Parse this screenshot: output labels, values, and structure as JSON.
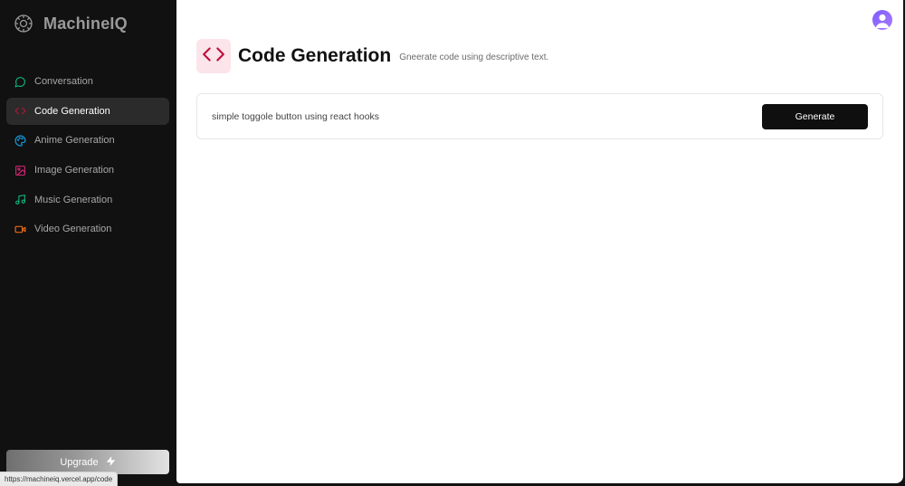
{
  "brand": {
    "name": "MachineIQ",
    "logo_icon": "brain-gear-icon"
  },
  "sidebar": {
    "items": [
      {
        "label": "Conversation",
        "icon": "chat-bubble-icon",
        "color": "#10b981",
        "active": false
      },
      {
        "label": "Code Generation",
        "icon": "code-icon",
        "color": "#be123c",
        "active": true
      },
      {
        "label": "Anime Generation",
        "icon": "palette-icon",
        "color": "#0ea5e9",
        "active": false
      },
      {
        "label": "Image Generation",
        "icon": "image-icon",
        "color": "#db2777",
        "active": false
      },
      {
        "label": "Music Generation",
        "icon": "music-icon",
        "color": "#10b981",
        "active": false
      },
      {
        "label": "Video Generation",
        "icon": "video-icon",
        "color": "#f97316",
        "active": false
      }
    ],
    "upgrade_label": "Upgrade",
    "upgrade_icon": "lightning-icon"
  },
  "status_bar": {
    "url": "https://machineiq.vercel.app/code"
  },
  "header": {
    "title": "Code Generation",
    "subtitle": "Gneerate code using descriptive text.",
    "icon": "code-icon",
    "icon_color": "#be123c",
    "icon_bg": "#fbe4ea"
  },
  "prompt": {
    "value": "simple toggole button using react hooks",
    "button_label": "Generate"
  },
  "colors": {
    "sidebar_bg": "#111111",
    "active_item_bg": "#2b2b2b",
    "accent_avatar": "#8b5cf6",
    "button_bg": "#0f0f0f"
  }
}
